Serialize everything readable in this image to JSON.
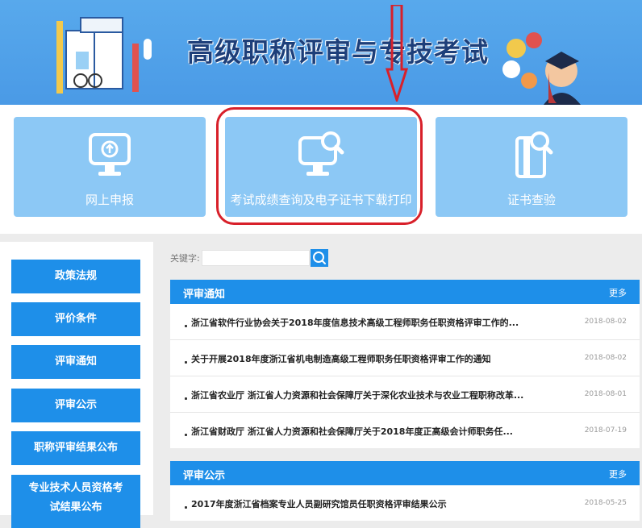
{
  "banner": {
    "title": "高级职称评审与专技考试"
  },
  "tiles": [
    {
      "label": "网上申报",
      "icon": "monitor-upload-icon"
    },
    {
      "label": "考试成绩查询及电子证书下载打印",
      "icon": "monitor-search-icon"
    },
    {
      "label": "证书查验",
      "icon": "certificate-search-icon"
    }
  ],
  "sidebar": {
    "items": [
      {
        "label": "政策法规"
      },
      {
        "label": "评价条件"
      },
      {
        "label": "评审通知"
      },
      {
        "label": "评审公示"
      },
      {
        "label": "职称评审结果公布"
      },
      {
        "label_line1": "专业技术人员资格考",
        "label_line2": "试结果公布"
      }
    ]
  },
  "search": {
    "label": "关键字:",
    "value": "",
    "placeholder": ""
  },
  "panels": {
    "notices": {
      "title": "评审通知",
      "more": "更多",
      "items": [
        {
          "title": "浙江省软件行业协会关于2018年度信息技术高级工程师职务任职资格评审工作的...",
          "date": "2018-08-02"
        },
        {
          "title": "关于开展2018年度浙江省机电制造高级工程师职务任职资格评审工作的通知",
          "date": "2018-08-02"
        },
        {
          "title": "浙江省农业厅 浙江省人力资源和社会保障厅关于深化农业技术与农业工程职称改革...",
          "date": "2018-08-01"
        },
        {
          "title": "浙江省财政厅 浙江省人力资源和社会保障厅关于2018年度正高级会计师职务任...",
          "date": "2018-07-19"
        }
      ]
    },
    "publicity": {
      "title": "评审公示",
      "more": "更多",
      "items": [
        {
          "title": "2017年度浙江省档案专业人员副研究馆员任职资格评审结果公示",
          "date": "2018-05-25"
        }
      ]
    }
  },
  "colors": {
    "accent": "#1e8fe9",
    "tile": "#8cc8f5",
    "annotation": "#d8202a",
    "banner": "#4a9ae6"
  }
}
